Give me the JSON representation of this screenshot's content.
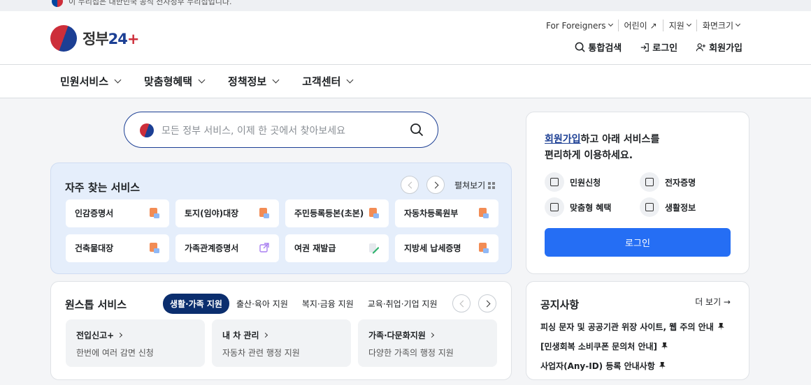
{
  "topbar": {
    "text": "이 누리집은 대한민국 공식 전자정부 누리집입니다."
  },
  "logo": {
    "text_a": "정부",
    "text_b": "24",
    "text_c": "+"
  },
  "util": {
    "foreigners": "For Foreigners",
    "kids": "어린이",
    "support": "지원",
    "font_size": "화면크기"
  },
  "actions": {
    "search": "통합검색",
    "login": "로그인",
    "signup": "회원가입"
  },
  "nav": {
    "items": [
      "민원서비스",
      "맞춤형혜택",
      "정책정보",
      "고객센터"
    ]
  },
  "search": {
    "placeholder": "모든 정부 서비스, 이제 한 곳에서 찾아보세요"
  },
  "frequent": {
    "title": "자주 찾는 서비스",
    "view_all": "펼쳐보기",
    "items": [
      "인감증명서",
      "토지(임야)대장",
      "주민등록등본(초본)",
      "자동차등록원부",
      "건축물대장",
      "가족관계증명서",
      "여권 재발급",
      "지방세 납세증명"
    ]
  },
  "onestop": {
    "title": "원스톱 서비스",
    "tabs": [
      "생활·가족 지원",
      "출산·육아 지원",
      "복지·금융 지원",
      "교육·취업·기업 지원"
    ],
    "services": [
      {
        "name": "전입신고+",
        "desc": "한번에 여러 감면 신청"
      },
      {
        "name": "내 차 관리",
        "desc": "자동차 관련 행정 지원"
      },
      {
        "name": "가족·다문화지원",
        "desc": "다양한 가족의 행정 지원"
      }
    ]
  },
  "login_box": {
    "signup_link": "회원가입",
    "msg_rest": "하고 아래 서비스를",
    "msg_line2": "편리하게 이용하세요.",
    "features": [
      "민원신청",
      "전자증명",
      "맞춤형 혜택",
      "생활정보"
    ],
    "button": "로그인"
  },
  "notice": {
    "title": "공지사항",
    "more": "더 보기 →",
    "items": [
      "피싱 문자 및 공공기관 위장 사이트, 웹 주의 안내",
      "[민생회복 소비쿠폰 문의처 안내]",
      "사업자(Any-ID) 등록 안내사항"
    ]
  },
  "colors": {
    "primary": "#256ef4",
    "navy": "#1c3f94",
    "tab_active": "#0b2e6e",
    "accent_red": "#cd2e3a"
  }
}
